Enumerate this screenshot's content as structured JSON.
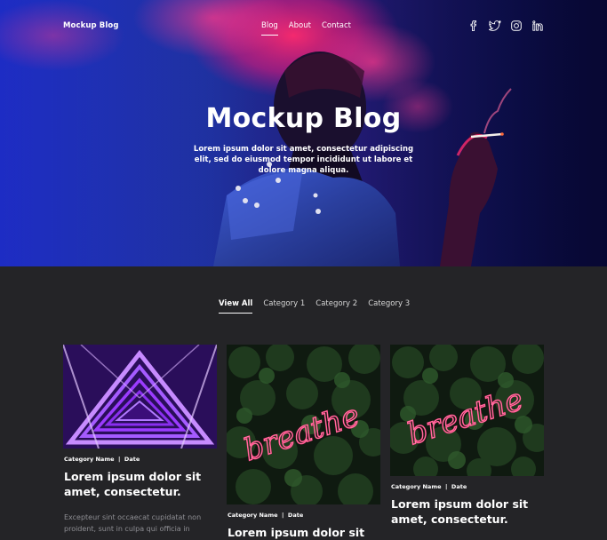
{
  "header": {
    "brand": "Mockup Blog",
    "nav": [
      {
        "label": "Blog",
        "active": true
      },
      {
        "label": "About",
        "active": false
      },
      {
        "label": "Contact",
        "active": false
      }
    ],
    "social_icons": [
      "facebook-icon",
      "twitter-icon",
      "instagram-icon",
      "linkedin-icon"
    ]
  },
  "hero": {
    "title": "Mockup Blog",
    "subtitle": "Lorem ipsum dolor sit amet, consectetur adipiscing elit, sed do eiusmod tempor incididunt ut labore et dolore magna aliqua."
  },
  "filters": [
    {
      "label": "View All",
      "active": true
    },
    {
      "label": "Category 1",
      "active": false
    },
    {
      "label": "Category 2",
      "active": false
    },
    {
      "label": "Category 3",
      "active": false
    }
  ],
  "posts": [
    {
      "meta": "Category Name  |  Date",
      "title": "Lorem ipsum dolor sit amet, consectetur.",
      "excerpt": "Excepteur sint occaecat cupidatat non proident, sunt in culpa qui officia in",
      "image": "neon-triangle-tunnel"
    },
    {
      "meta": "Category Name  |  Date",
      "title": "Lorem ipsum dolor sit",
      "image": "breathe-neon-sign"
    },
    {
      "meta": "Category Name  |  Date",
      "title": "Lorem ipsum dolor sit amet, consectetur.",
      "image": "breathe-neon-sign"
    }
  ],
  "colors": {
    "background": "#242427",
    "hero_blue": "#2a43d8",
    "neon_pink": "#ff2a6d",
    "neon_purple": "#9b3bff",
    "muted_text": "#8e8e93"
  }
}
